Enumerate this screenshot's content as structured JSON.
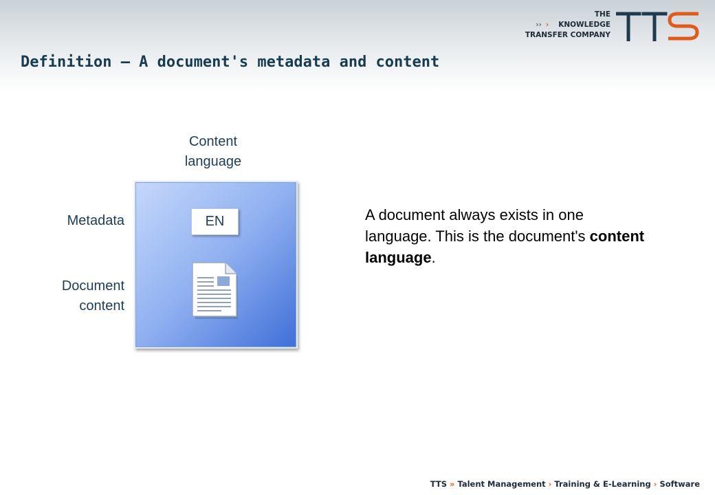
{
  "slide": {
    "title": "Definition – A document's metadata and content"
  },
  "logo": {
    "line1": "THE",
    "line2_chevrons": "››",
    "line2_chevron_accent": "›",
    "line2": "KNOWLEDGE",
    "line3": "TRANSFER COMPANY",
    "mark_text": "TTS",
    "accent_color": "#e05a1c",
    "dark_color": "#1e3a4f"
  },
  "diagram": {
    "content_language_label_line1": "Content",
    "content_language_label_line2": "language",
    "metadata_label": "Metadata",
    "document_content_label_line1": "Document",
    "document_content_label_line2": "content",
    "language_badge": "EN",
    "document_icon": "document-icon"
  },
  "description": {
    "text_before": "A document always exists in one language. This is the document's ",
    "emphasis": "content language",
    "text_after": "."
  },
  "footer": {
    "brand": "TTS",
    "sep1": "»",
    "item1": "Talent Management",
    "sep2": "›",
    "item2": "Training & E-Learning",
    "sep3": "›",
    "item3": "Software"
  }
}
